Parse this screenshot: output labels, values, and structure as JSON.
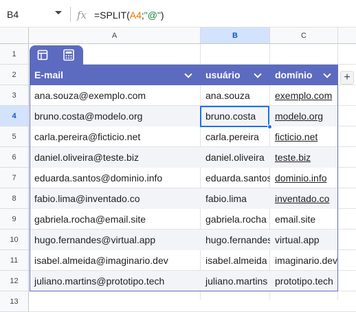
{
  "formula_bar": {
    "cell_ref": "B4",
    "fx_label": "fx",
    "formula_prefix": "=SPLIT(",
    "formula_ref": "A4",
    "formula_sep": ";",
    "formula_string": "\"@\"",
    "formula_suffix": ")"
  },
  "columns": [
    "A",
    "B",
    "C"
  ],
  "selected_column": "B",
  "rows": [
    "1",
    "2",
    "3",
    "4",
    "5",
    "6",
    "7",
    "8",
    "9",
    "10",
    "11",
    "12",
    "13"
  ],
  "selected_row": "4",
  "table": {
    "headers": [
      "E-mail",
      "usuário",
      "domínio"
    ],
    "icons": [
      "table-icon",
      "calculator-icon"
    ],
    "header_color": "#5c6bc0",
    "band_color": "#f3f4f8",
    "rows": [
      {
        "email": "ana.souza@exemplo.com",
        "user": "ana.souza",
        "domain": "exemplo.com",
        "domain_link": true
      },
      {
        "email": "bruno.costa@modelo.org",
        "user": "bruno.costa",
        "domain": "modelo.org",
        "domain_link": true
      },
      {
        "email": "carla.pereira@ficticio.net",
        "user": "carla.pereira",
        "domain": "ficticio.net",
        "domain_link": true
      },
      {
        "email": "daniel.oliveira@teste.biz",
        "user": "daniel.oliveira",
        "domain": "teste.biz",
        "domain_link": true
      },
      {
        "email": "eduarda.santos@dominio.info",
        "user": "eduarda.santos",
        "domain": "dominio.info",
        "domain_link": true
      },
      {
        "email": "fabio.lima@inventado.co",
        "user": "fabio.lima",
        "domain": "inventado.co",
        "domain_link": true
      },
      {
        "email": "gabriela.rocha@email.site",
        "user": "gabriela.rocha",
        "domain": "email.site",
        "domain_link": false
      },
      {
        "email": "hugo.fernandes@virtual.app",
        "user": "hugo.fernandes",
        "domain": "virtual.app",
        "domain_link": false
      },
      {
        "email": "isabel.almeida@imaginario.dev",
        "user": "isabel.almeida",
        "domain": "imaginario.dev",
        "domain_link": false
      },
      {
        "email": "juliano.martins@prototipo.tech",
        "user": "juliano.martins",
        "domain": "prototipo.tech",
        "domain_link": false
      }
    ]
  },
  "add_column_label": "+"
}
